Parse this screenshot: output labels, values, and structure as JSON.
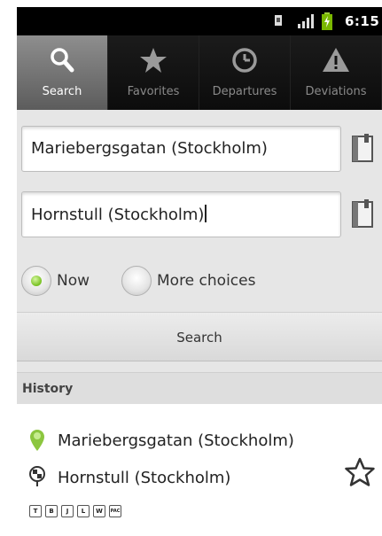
{
  "status_bar": {
    "time": "6:15",
    "icons": [
      "sim-card-icon",
      "signal-icon",
      "battery-charging-icon"
    ]
  },
  "tabs": [
    {
      "label": "Search",
      "icon": "search-icon",
      "active": true
    },
    {
      "label": "Favorites",
      "icon": "star-icon",
      "active": false
    },
    {
      "label": "Departures",
      "icon": "clock-icon",
      "active": false
    },
    {
      "label": "Deviations",
      "icon": "warning-icon",
      "active": false
    }
  ],
  "search": {
    "from_value": "Mariebergsgatan (Stockholm)",
    "to_value": "Hornstull (Stockholm)",
    "time_options": [
      {
        "label": "Now",
        "selected": true
      },
      {
        "label": "More choices",
        "selected": false
      }
    ],
    "search_button_label": "Search"
  },
  "history": {
    "header": "History",
    "items": [
      {
        "from": "Mariebergsgatan (Stockholm)",
        "to": "Hornstull (Stockholm)",
        "transport_modes": [
          "T",
          "B",
          "J",
          "L",
          "W",
          "PAC"
        ]
      }
    ]
  },
  "colors": {
    "accent_green": "#76c020",
    "tab_bar_bg": "#111111",
    "active_tab_bg": "#7a7a7a",
    "panel_bg": "#e6e6e6"
  }
}
